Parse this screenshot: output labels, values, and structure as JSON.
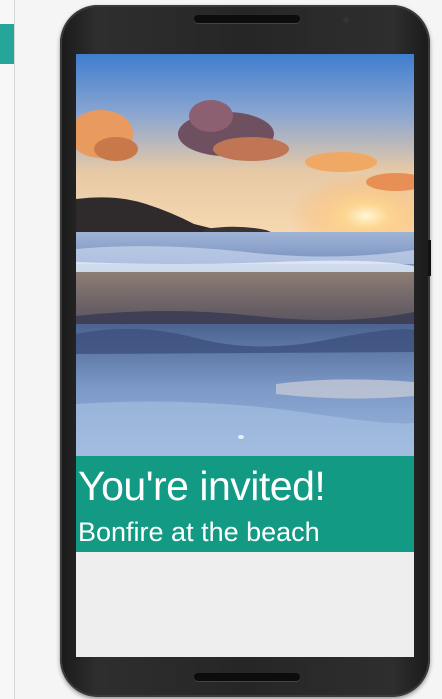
{
  "card": {
    "title": "You're invited!",
    "subtitle": "Bonfire at the beach"
  },
  "hero_image": {
    "icon": "beach-sunset-photo"
  },
  "colors": {
    "banner": "#129a84",
    "accent": "#26a69a",
    "text": "#ffffff",
    "screen_background": "#eeeeee"
  }
}
